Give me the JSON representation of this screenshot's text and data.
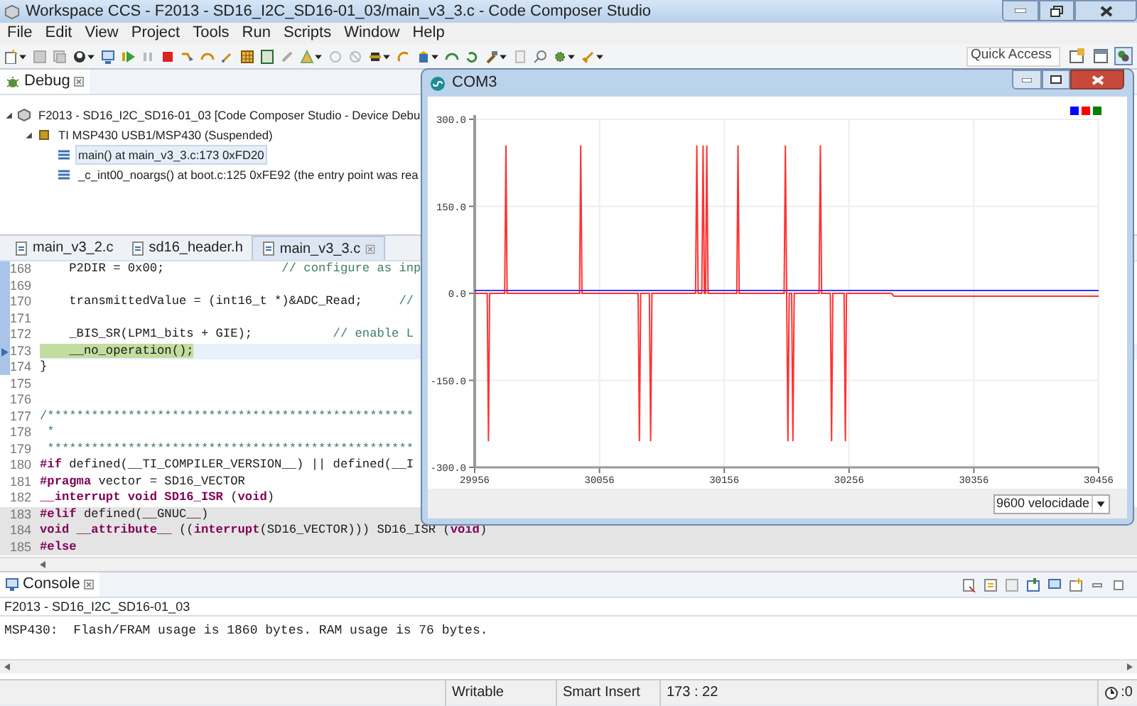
{
  "window": {
    "title": "Workspace CCS - F2013 - SD16_I2C_SD16-01_03/main_v3_3.c - Code Composer Studio"
  },
  "menu": [
    "File",
    "Edit",
    "View",
    "Project",
    "Tools",
    "Run",
    "Scripts",
    "Window",
    "Help"
  ],
  "toolbar": {
    "quick_access": {
      "placeholder": "Quick Access"
    }
  },
  "debug_view": {
    "tab": "Debug",
    "tree": [
      {
        "kind": "launch",
        "label": "F2013 - SD16_I2C_SD16-01_03 [Code Composer Studio - Device Debu",
        "expanded": true,
        "selected": false,
        "children": [
          {
            "kind": "device",
            "label": "TI MSP430 USB1/MSP430 (Suspended)",
            "expanded": true,
            "selected": false,
            "children": [
              {
                "kind": "frame",
                "label": "main() at main_v3_3.c:173 0xFD20",
                "selected": true
              },
              {
                "kind": "frame",
                "label": "_c_int00_noargs() at boot.c:125 0xFE92  (the entry point was rea",
                "selected": false
              }
            ]
          }
        ]
      }
    ]
  },
  "editor": {
    "tabs": [
      {
        "label": "main_v3_2.c",
        "selected": false
      },
      {
        "label": "sd16_header.h",
        "selected": false
      },
      {
        "label": "main_v3_3.c",
        "selected": true
      }
    ],
    "lines": [
      {
        "number": "168",
        "code": "    P2DIR = 0x00;",
        "comment": "                // configure as inp",
        "current": false,
        "inactive": false
      },
      {
        "number": "169",
        "current": false,
        "inactive": false
      },
      {
        "number": "170",
        "code": "    transmittedValue = (int16_t *)&ADC_Read;",
        "comment": "     //",
        "current": false,
        "inactive": false
      },
      {
        "number": "171",
        "current": false,
        "inactive": false
      },
      {
        "number": "172",
        "code": "    _BIS_SR(LPM1_bits + GIE);",
        "comment": "           // enable L",
        "current": false,
        "inactive": false
      },
      {
        "number": "173",
        "code": "    __no_operation();",
        "current": true,
        "inactive": false
      },
      {
        "number": "174",
        "code": "}",
        "current": false,
        "inactive": false
      },
      {
        "number": "175",
        "current": false,
        "inactive": false
      },
      {
        "number": "176",
        "current": false,
        "inactive": false
      },
      {
        "number": "177",
        "comment": "/**************************************************",
        "current": false,
        "inactive": false
      },
      {
        "number": "178",
        "comment": " *",
        "current": false,
        "inactive": false
      },
      {
        "number": "179",
        "comment": " **************************************************",
        "current": false,
        "inactive": false
      },
      {
        "number": "180",
        "code": "**#if** defined(__TI_COMPILER_VERSION__) || defined(__I",
        "current": false,
        "inactive": false
      },
      {
        "number": "181",
        "code": "**#pragma** vector = SD16_VECTOR",
        "current": false,
        "inactive": false
      },
      {
        "number": "182",
        "code": "**__interrupt void SD16_ISR** (**void**)",
        "current": false,
        "inactive": false
      },
      {
        "number": "183",
        "code": "**#elif** defined(__GNUC__)",
        "current": false,
        "inactive": true
      },
      {
        "number": "184",
        "code": "**void __attribute__** ((**interrupt**(SD16_VECTOR))) SD16_ISR (**void**)",
        "current": false,
        "inactive": true
      },
      {
        "number": "185",
        "code": "**#else**",
        "current": false,
        "inactive": true
      }
    ]
  },
  "console": {
    "tab": "Console",
    "subtitle": "F2013 - SD16_I2C_SD16-01_03",
    "output": "MSP430:  Flash/FRAM usage is 1860 bytes. RAM usage is 76 bytes."
  },
  "status_bar": [
    "Writable",
    "Smart Insert",
    "173 : 22",
    ":0"
  ],
  "plotter": {
    "title": "COM3",
    "baud_dropdown": "9600 velocidade",
    "chart_data": {
      "type": "line",
      "grid": true,
      "xlim": [
        29956,
        30456
      ],
      "ylim": [
        -300,
        300
      ],
      "xticks": [
        29956,
        30056,
        30156,
        30256,
        30356,
        30456
      ],
      "yticks": [
        {
          "value": 300,
          "label": "300.0"
        },
        {
          "value": 150,
          "label": "150.0"
        },
        {
          "value": 0,
          "label": "0.0"
        },
        {
          "value": -150,
          "label": "-150.0"
        },
        {
          "value": -300,
          "label": "-300.0"
        }
      ],
      "x": [
        29956,
        29966,
        29967,
        29968,
        29980,
        29981,
        29982,
        30040,
        30041,
        30042,
        30087,
        30088,
        30089,
        30096,
        30097,
        30098,
        30133,
        30134,
        30135,
        30138,
        30139,
        30140,
        30141,
        30142,
        30143,
        30166,
        30167,
        30168,
        30204,
        30205,
        30206,
        30207,
        30208,
        30210,
        30211,
        30212,
        30232,
        30233,
        30234,
        30241,
        30242,
        30243,
        30252,
        30253,
        30254,
        30290,
        30292,
        30456
      ],
      "series": [
        {
          "color": "#0000ff",
          "values": [
            5,
            5,
            5,
            5,
            5,
            5,
            5,
            5,
            5,
            5,
            5,
            5,
            5,
            5,
            5,
            5,
            5,
            5,
            5,
            5,
            5,
            5,
            5,
            5,
            5,
            5,
            5,
            5,
            5,
            5,
            5,
            5,
            5,
            5,
            5,
            5,
            5,
            5,
            5,
            5,
            5,
            5,
            5,
            5,
            5,
            5,
            5,
            5
          ]
        },
        {
          "color": "#ff0000",
          "values": [
            0,
            0,
            -255,
            0,
            0,
            255,
            0,
            0,
            255,
            0,
            0,
            -255,
            0,
            0,
            -255,
            0,
            0,
            255,
            0,
            0,
            255,
            0,
            0,
            255,
            0,
            0,
            255,
            0,
            0,
            255,
            0,
            -255,
            0,
            0,
            -255,
            0,
            0,
            255,
            0,
            0,
            -255,
            0,
            0,
            -255,
            0,
            0,
            -5,
            -5
          ]
        },
        {
          "color": "#008000",
          "values": [
            null,
            null,
            null,
            null,
            null,
            null,
            null,
            null,
            null,
            null,
            null,
            null,
            null,
            null,
            null,
            null,
            null,
            null,
            null,
            null,
            null,
            null,
            null,
            null,
            null,
            null,
            null,
            null,
            null,
            null,
            null,
            null,
            null,
            null,
            null,
            null,
            null,
            null,
            null,
            null,
            null,
            null,
            null,
            null,
            null,
            null,
            null,
            null
          ]
        }
      ]
    }
  }
}
